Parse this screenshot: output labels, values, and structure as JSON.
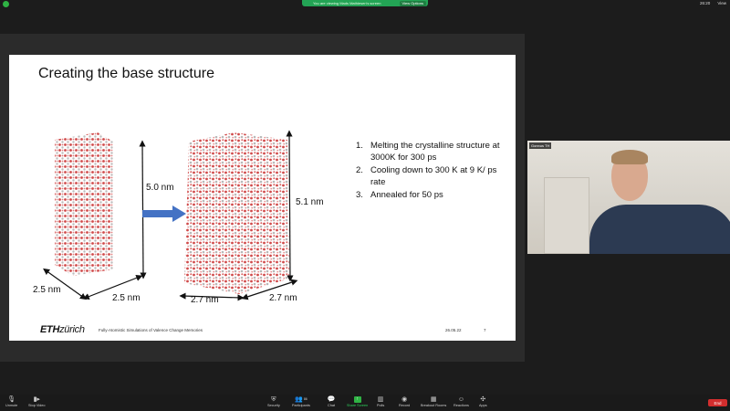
{
  "topbar": {
    "share_message": "You are viewing Mads Mathiesen's screen",
    "view_options_label": "View Options",
    "time": "26:20",
    "view_label": "View"
  },
  "slide": {
    "title": "Creating the base structure",
    "dims": {
      "left_height": "5.0 nm",
      "left_width_a": "2.5 nm",
      "left_width_b": "2.5 nm",
      "right_height": "5.1 nm",
      "right_width_a": "2.7 nm",
      "right_width_b": "2.7 nm"
    },
    "steps": [
      {
        "num": "1.",
        "text": "Melting the crystalline structure at 3000K for 300 ps"
      },
      {
        "num": "2.",
        "text": "Cooling down to 300 K at 9 K/ ps rate"
      },
      {
        "num": "3.",
        "text": "Annealed for 50 ps"
      }
    ],
    "footer": {
      "logo_eth": "ETH",
      "logo_zurich": "zürich",
      "talk_title": "Fully-Atomistic Simulations of Valence Change Memories",
      "date": "26.05.22",
      "page": "7"
    }
  },
  "video": {
    "participant_name": "Gonnus TH"
  },
  "toolbar": {
    "items": [
      {
        "label": "Unmute",
        "icon": "microphone-muted-icon"
      },
      {
        "label": "Stop Video",
        "icon": "video-camera-icon"
      },
      {
        "label": "Security",
        "icon": "shield-icon"
      },
      {
        "label": "Participants",
        "icon": "participants-icon",
        "count": "86"
      },
      {
        "label": "Chat",
        "icon": "chat-icon"
      },
      {
        "label": "Share Screen",
        "icon": "share-screen-icon"
      },
      {
        "label": "Polls",
        "icon": "polls-icon"
      },
      {
        "label": "Record",
        "icon": "record-icon"
      },
      {
        "label": "Breakout Rooms",
        "icon": "breakout-rooms-icon"
      },
      {
        "label": "Reactions",
        "icon": "reactions-icon"
      },
      {
        "label": "Apps",
        "icon": "apps-icon"
      }
    ],
    "end_label": "End"
  },
  "colors": {
    "share_green": "#23a455",
    "end_red": "#d22e2e",
    "arrow_blue": "#4472c4"
  }
}
